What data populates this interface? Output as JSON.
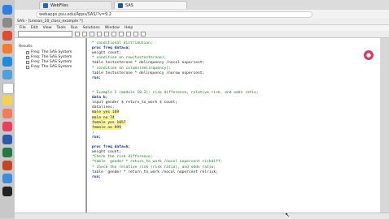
{
  "browser": {
    "tabs": [
      {
        "label": "WebFiles"
      },
      {
        "label": "SAS"
      }
    ],
    "address": "webapps.psu.edu/Apps/SAS/?v=9.2"
  },
  "sas": {
    "title": "SAS - [Lesson_10_class_example *]",
    "menu": [
      "File",
      "Edit",
      "View",
      "Tools",
      "Run",
      "Solutions",
      "Window",
      "Help"
    ],
    "results": {
      "title": "Results",
      "items": [
        "Freq: The SAS System",
        "Freq: The SAS System",
        "Freq: The SAS System",
        "Freq: The SAS System"
      ]
    },
    "code": [
      {
        "cls": "cm",
        "text": "* conditional distribution;"
      },
      {
        "cls": "kw",
        "text": "proc freq data=a;"
      },
      {
        "cls": "",
        "text": "weight count;"
      },
      {
        "cls": "cm",
        "text": "* condition on row(testosterone);"
      },
      {
        "cls": "",
        "text": "table testosterone * delinquency /nocol nopercent;"
      },
      {
        "cls": "cm",
        "text": "* condition on column(delinquency);"
      },
      {
        "cls": "",
        "text": "table testosterone * delinquency /norow nopercent;"
      },
      {
        "cls": "kw",
        "text": "run;"
      },
      {
        "cls": "",
        "text": ""
      },
      {
        "cls": "",
        "text": ""
      },
      {
        "cls": "cm",
        "text": "* Example 2 (module 10.2): risk difference, relative risk, and odds ratio;"
      },
      {
        "cls": "kw",
        "text": "data b;"
      },
      {
        "cls": "",
        "text": "input gender $ return_to_work $ count;"
      },
      {
        "cls": "",
        "text": "datalines;"
      },
      {
        "cls": "data",
        "text": "male yes 169"
      },
      {
        "cls": "data",
        "text": "male no 74"
      },
      {
        "cls": "data",
        "text": "female yes 1057"
      },
      {
        "cls": "data",
        "text": "female no 999"
      },
      {
        "cls": "",
        "text": ";"
      },
      {
        "cls": "kw",
        "text": "run;"
      },
      {
        "cls": "",
        "text": ""
      },
      {
        "cls": "kw",
        "text": "proc freq data=b;"
      },
      {
        "cls": "",
        "text": "weight count;"
      },
      {
        "cls": "cm",
        "text": "*Check the risk difference;"
      },
      {
        "cls": "cm",
        "text": "*table  gender * return_to_work /nocol nopercent riskdiff;"
      },
      {
        "cls": "cm",
        "text": "* check the relative risk (risk ratio), and odds ratio;"
      },
      {
        "cls": "",
        "text": "table  gender * return_to_work /nocol nopercent relrisk;"
      },
      {
        "cls": "kw",
        "text": "run;"
      }
    ]
  }
}
